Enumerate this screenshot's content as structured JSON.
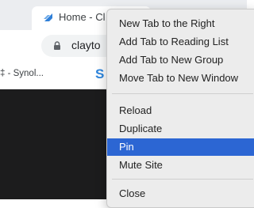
{
  "tabs": {
    "active_title": "Home - Cl",
    "favicon": "blue-arrow-favicon"
  },
  "toolbar": {
    "url": "clayto"
  },
  "bookmarks": {
    "item1": "‡ - Synol...",
    "item2_icon": "S"
  },
  "menu": {
    "items": [
      {
        "label": "New Tab to the Right"
      },
      {
        "label": "Add Tab to Reading List"
      },
      {
        "label": "Add Tab to New Group"
      },
      {
        "label": "Move Tab to New Window"
      },
      {
        "label": "Reload"
      },
      {
        "label": "Duplicate"
      },
      {
        "label": "Pin"
      },
      {
        "label": "Mute Site"
      },
      {
        "label": "Close"
      }
    ],
    "highlighted": "Pin",
    "highlight_color": "#2c66d3"
  }
}
